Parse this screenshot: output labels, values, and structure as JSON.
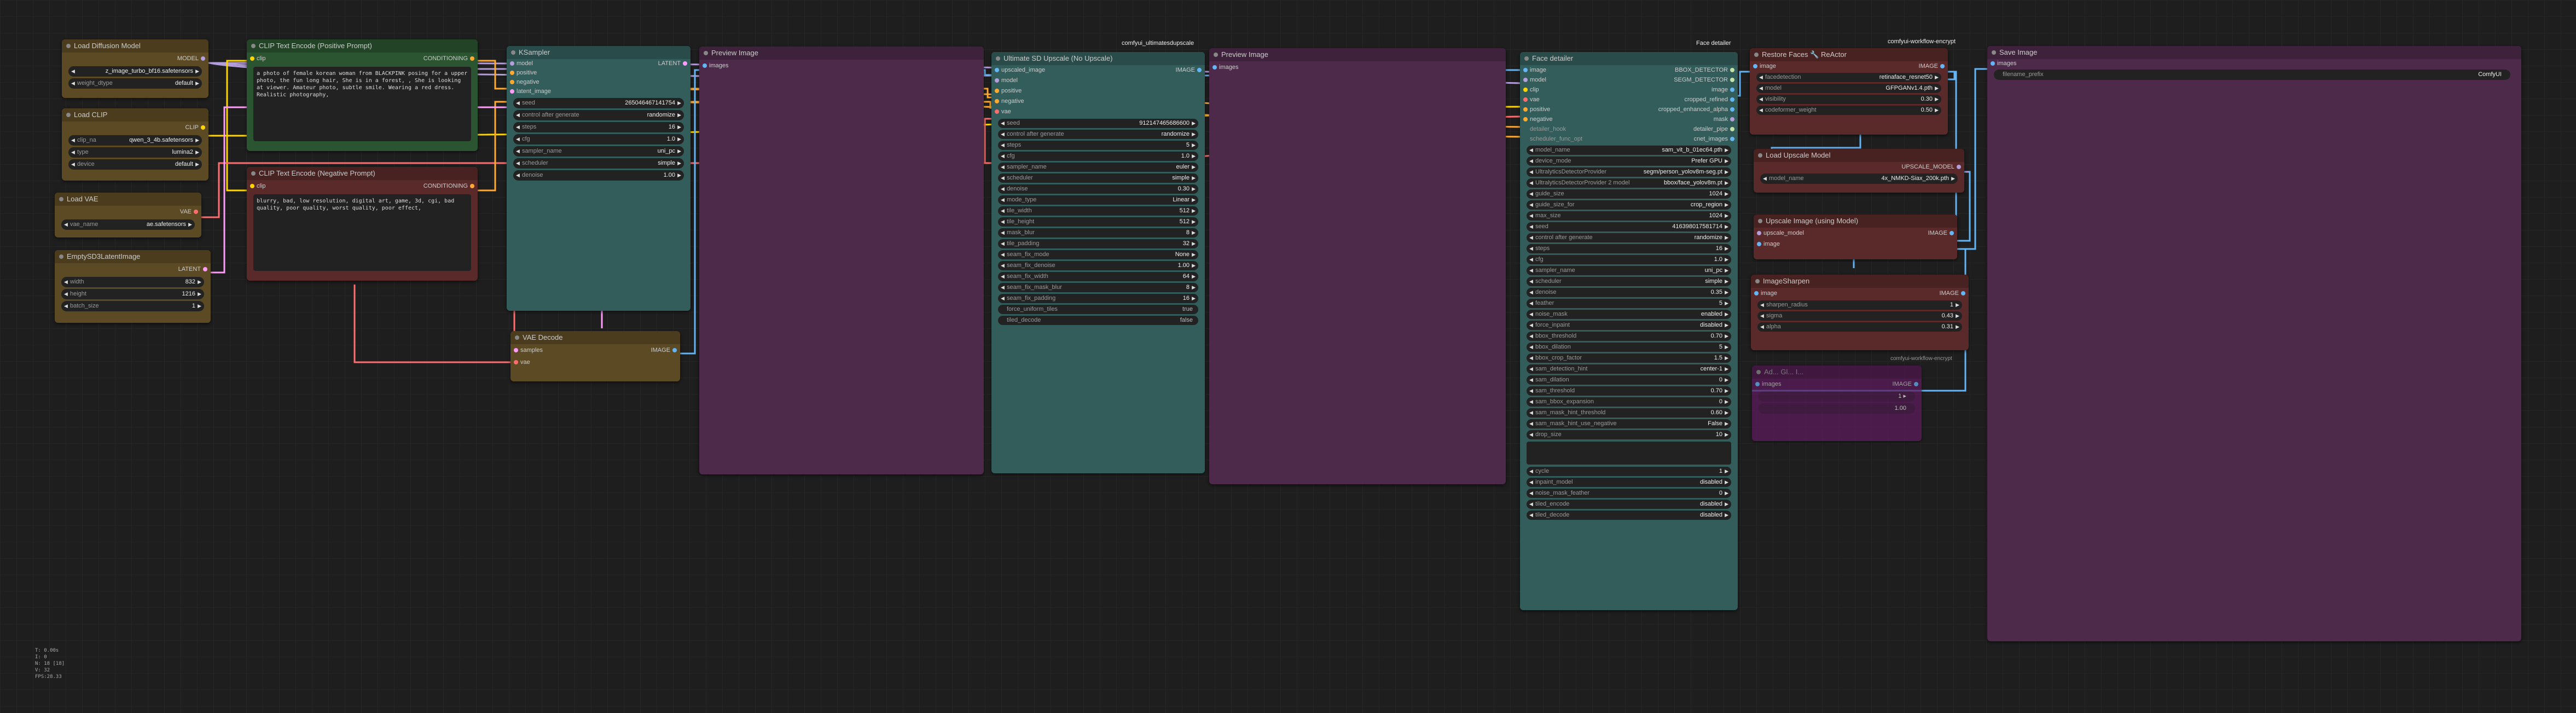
{
  "groups": {
    "ultimate": "comfyui_ultimatesdupscale",
    "face": "Face detailer",
    "workflow": "comfyui-workflow-encrypt",
    "workflow2": "comfyui-workflow-encrypt"
  },
  "colors": {
    "bg": "#1e1e1e",
    "brown": "#5b4a24",
    "green": "#2b5430",
    "red": "#5a2a2a",
    "teal": "#335d5b",
    "purple": "#4d2a4a",
    "magenta": "#5a1a5a"
  },
  "nodes": {
    "load_diffusion": {
      "title": "Load Diffusion Model",
      "out_label": "MODEL",
      "widgets": [
        {
          "label": "",
          "value": "z_image_turbo_bf16.safetensors"
        },
        {
          "label": "weight_dtype",
          "value": "default"
        }
      ]
    },
    "load_clip": {
      "title": "Load CLIP",
      "out_label": "CLIP",
      "widgets": [
        {
          "label": "clip_na",
          "value": "qwen_3_4b.safetensors"
        },
        {
          "label": "type",
          "value": "lumina2"
        },
        {
          "label": "device",
          "value": "default"
        }
      ]
    },
    "load_vae": {
      "title": "Load VAE",
      "out_label": "VAE",
      "widgets": [
        {
          "label": "vae_name",
          "value": "ae.safetensors"
        }
      ]
    },
    "empty_latent": {
      "title": "EmptySD3LatentImage",
      "out_label": "LATENT",
      "widgets": [
        {
          "label": "width",
          "value": "832"
        },
        {
          "label": "height",
          "value": "1216"
        },
        {
          "label": "batch_size",
          "value": "1"
        }
      ]
    },
    "clip_pos": {
      "title": "CLIP Text Encode (Positive Prompt)",
      "in_label": "clip",
      "out_label": "CONDITIONING",
      "text": "a photo of female korean woman from BLACKPINK posing for a upper photo, the fun long hair, She is in a forest, , She is looking at viewer. Amateur photo, subtle smile. Wearing a red dress. Realistic photography,"
    },
    "clip_neg": {
      "title": "CLIP Text Encode (Negative Prompt)",
      "in_label": "clip",
      "out_label": "CONDITIONING",
      "text": "blurry, bad, low resolution, digital art, game, 3d, cgi, bad quality, poor quality, worst quality, poor effect,"
    },
    "ksampler": {
      "title": "KSampler",
      "inputs": [
        "model",
        "positive",
        "negative",
        "latent_image"
      ],
      "out_label": "LATENT",
      "widgets": [
        {
          "label": "seed",
          "value": "265046467141754"
        },
        {
          "label": "control after generate",
          "value": "randomize"
        },
        {
          "label": "steps",
          "value": "16"
        },
        {
          "label": "cfg",
          "value": "1.0"
        },
        {
          "label": "sampler_name",
          "value": "uni_pc"
        },
        {
          "label": "scheduler",
          "value": "simple"
        },
        {
          "label": "denoise",
          "value": "1.00"
        }
      ]
    },
    "vae_decode": {
      "title": "VAE Decode",
      "inputs": [
        "samples",
        "vae"
      ],
      "out_label": "IMAGE"
    },
    "preview1": {
      "title": "Preview Image",
      "inputs": [
        "images"
      ]
    },
    "ultimate": {
      "title": "Ultimate SD Upscale (No Upscale)",
      "inputs": [
        "upscaled_image",
        "model",
        "positive",
        "negative",
        "vae"
      ],
      "out_label": "IMAGE",
      "widgets": [
        {
          "label": "seed",
          "value": "912147465686600"
        },
        {
          "label": "control after generate",
          "value": "randomize"
        },
        {
          "label": "steps",
          "value": "5"
        },
        {
          "label": "cfg",
          "value": "1.0"
        },
        {
          "label": "sampler_name",
          "value": "euler"
        },
        {
          "label": "scheduler",
          "value": "simple"
        },
        {
          "label": "denoise",
          "value": "0.30"
        },
        {
          "label": "mode_type",
          "value": "Linear"
        },
        {
          "label": "tile_width",
          "value": "512"
        },
        {
          "label": "tile_height",
          "value": "512"
        },
        {
          "label": "mask_blur",
          "value": "8"
        },
        {
          "label": "tile_padding",
          "value": "32"
        },
        {
          "label": "seam_fix_mode",
          "value": "None"
        },
        {
          "label": "seam_fix_denoise",
          "value": "1.00"
        },
        {
          "label": "seam_fix_width",
          "value": "64"
        },
        {
          "label": "seam_fix_mask_blur",
          "value": "8"
        },
        {
          "label": "seam_fix_padding",
          "value": "16"
        }
      ],
      "toggles": [
        {
          "label": "force_uniform_tiles",
          "value": "true"
        },
        {
          "label": "tiled_decode",
          "value": "false"
        }
      ]
    },
    "preview2": {
      "title": "Preview Image",
      "inputs": [
        "images"
      ]
    },
    "face": {
      "title": "Face detailer",
      "inputs": [
        "image",
        "model",
        "clip",
        "vae",
        "positive",
        "negative"
      ],
      "outputs": [
        "BBOX_DETECTOR",
        "SEGM_DETECTOR",
        "image",
        "cropped_refined",
        "cropped_enhanced_alpha",
        "mask",
        "detailer_pipe",
        "cnet_images"
      ],
      "extra_in": [
        "detailer_hook",
        "scheduler_func_opt"
      ],
      "widgets": [
        {
          "label": "model_name",
          "value": "sam_vit_b_01ec64.pth"
        },
        {
          "label": "device_mode",
          "value": "Prefer GPU"
        },
        {
          "label": "UltralyticsDetectorProvider",
          "value": "segm/person_yolov8m-seg.pt"
        },
        {
          "label": "UltralyticsDetectorProvider 2 model",
          "value": "bbox/face_yolov8m.pt"
        },
        {
          "label": "guide_size",
          "value": "1024"
        },
        {
          "label": "guide_size_for",
          "value": "crop_region"
        },
        {
          "label": "max_size",
          "value": "1024"
        },
        {
          "label": "seed",
          "value": "416398017581714"
        },
        {
          "label": "control after generate",
          "value": "randomize"
        },
        {
          "label": "steps",
          "value": "16"
        },
        {
          "label": "cfg",
          "value": "1.0"
        },
        {
          "label": "sampler_name",
          "value": "uni_pc"
        },
        {
          "label": "scheduler",
          "value": "simple"
        },
        {
          "label": "denoise",
          "value": "0.35"
        },
        {
          "label": "feather",
          "value": "5"
        },
        {
          "label": "noise_mask",
          "value": "enabled"
        },
        {
          "label": "force_inpaint",
          "value": "disabled"
        },
        {
          "label": "bbox_threshold",
          "value": "0.70"
        },
        {
          "label": "bbox_dilation",
          "value": "5"
        },
        {
          "label": "bbox_crop_factor",
          "value": "1.5"
        },
        {
          "label": "sam_detection_hint",
          "value": "center-1"
        },
        {
          "label": "sam_dilation",
          "value": "0"
        },
        {
          "label": "sam_threshold",
          "value": "0.70"
        },
        {
          "label": "sam_bbox_expansion",
          "value": "0"
        },
        {
          "label": "sam_mask_hint_threshold",
          "value": "0.60"
        },
        {
          "label": "sam_mask_hint_use_negative",
          "value": "False"
        },
        {
          "label": "drop_size",
          "value": "10"
        }
      ],
      "widgets2": [
        {
          "label": "cycle",
          "value": "1"
        },
        {
          "label": "inpaint_model",
          "value": "disabled"
        },
        {
          "label": "noise_mask_feather",
          "value": "0"
        },
        {
          "label": "tiled_encode",
          "value": "disabled"
        },
        {
          "label": "tiled_decode",
          "value": "disabled"
        }
      ]
    },
    "restore": {
      "title": "Restore Faces 🔧 ReActor",
      "in_label": "image",
      "out_label": "IMAGE",
      "widgets": [
        {
          "label": "facedetection",
          "value": "retinaface_resnet50"
        },
        {
          "label": "model",
          "value": "GFPGANv1.4.pth"
        },
        {
          "label": "visibility",
          "value": "0.30"
        },
        {
          "label": "codeformer_weight",
          "value": "0.50"
        }
      ]
    },
    "load_upscale": {
      "title": "Load Upscale Model",
      "out_label": "UPSCALE_MODEL",
      "widgets": [
        {
          "label": "model_name",
          "value": "4x_NMKD-Siax_200k.pth"
        }
      ]
    },
    "upscale_img": {
      "title": "Upscale Image (using Model)",
      "inputs": [
        "upscale_model",
        "image"
      ],
      "out_label": "IMAGE"
    },
    "sharpen": {
      "title": "ImageSharpen",
      "in_label": "image",
      "out_label": "IMAGE",
      "widgets": [
        {
          "label": "sharpen_radius",
          "value": "1"
        },
        {
          "label": "sigma",
          "value": "0.43"
        },
        {
          "label": "alpha",
          "value": "0.31"
        }
      ]
    },
    "decrypt": {
      "title": "Ad... Gl... I...",
      "in_label": "images",
      "out_label": "IMAGE",
      "widgets": [
        {
          "label": "",
          "value": "1 ▸"
        },
        {
          "label": "",
          "value": "1.00"
        }
      ]
    },
    "save": {
      "title": "Save Image",
      "in_label": "images",
      "widgets": [
        {
          "label": "filename_prefix",
          "value": "ComfyUI"
        }
      ]
    }
  },
  "stats": [
    "T: 0.00s",
    "I: 0",
    "N: 18 [18]",
    "V: 32",
    "FPS:28.33"
  ]
}
